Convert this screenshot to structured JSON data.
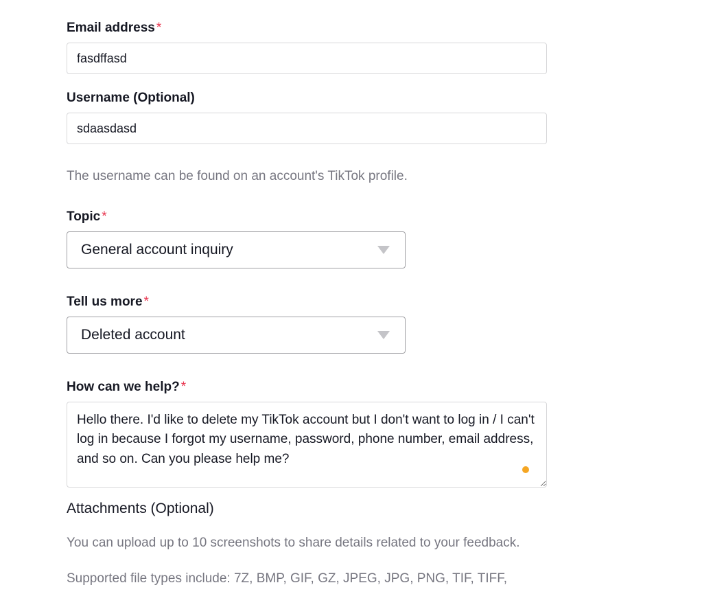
{
  "fields": {
    "email": {
      "label": "Email address",
      "required": true,
      "value": "fasdffasd"
    },
    "username": {
      "label": "Username (Optional)",
      "required": false,
      "value": "sdaasdasd",
      "helper": "The username can be found on an account's TikTok profile."
    },
    "topic": {
      "label": "Topic",
      "required": true,
      "value": "General account inquiry"
    },
    "tellmore": {
      "label": "Tell us more",
      "required": true,
      "value": "Deleted account"
    },
    "help": {
      "label": "How can we help?",
      "required": true,
      "value": "Hello there. I'd like to delete my TikTok account but I don't want to log in / I can't log in because I forgot my username, password, phone number, email address, and so on. Can you please help me?"
    }
  },
  "attachments": {
    "title": "Attachments (Optional)",
    "info1": "You can upload up to 10 screenshots to share details related to your feedback.",
    "info2": "Supported file types include: 7Z, BMP, GIF, GZ, JPEG, JPG, PNG, TIF, TIFF,"
  },
  "asterisk": "*"
}
